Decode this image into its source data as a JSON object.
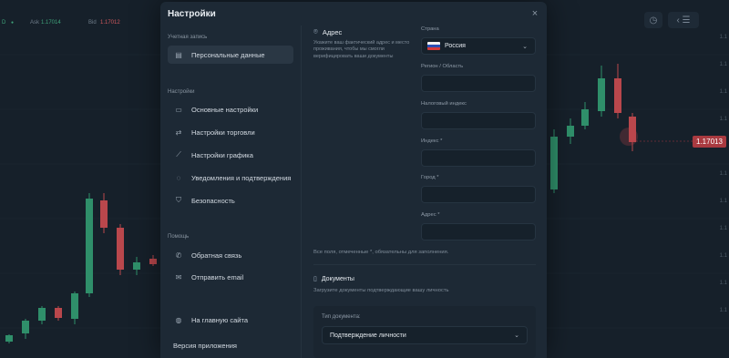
{
  "chart_bar": {
    "symbol_fragment": "D",
    "ask_label": "Ask",
    "ask_value": "1.17014",
    "bid_label": "Bid",
    "bid_value": "1.17012",
    "current_price": "1.17013"
  },
  "modal": {
    "title": "Настройки",
    "close_glyph": "×"
  },
  "sidebar": {
    "account_section": "Учетная запись",
    "personal_data": "Персональные данные",
    "settings_section": "Настройки",
    "items": [
      {
        "label": "Основные настройки",
        "icon": "laptop-icon"
      },
      {
        "label": "Настройки торговли",
        "icon": "exchange-icon"
      },
      {
        "label": "Настройки графика",
        "icon": "chart-icon"
      },
      {
        "label": "Уведомления и подтверждения",
        "icon": "bell-icon"
      },
      {
        "label": "Безопасность",
        "icon": "shield-icon"
      }
    ],
    "help_section": "Помощь",
    "feedback": "Обратная связь",
    "send_email": "Отправить email",
    "home_site": "На главную сайта",
    "app_version": "Версия приложения"
  },
  "address": {
    "title": "Адрес",
    "description": "Укажите ваш фактический адрес и место проживания, чтобы мы смогли верифицировать ваши документы",
    "country_label": "Страна",
    "country_value": "Россия",
    "region_label": "Регион / Область",
    "tax_label": "Налоговый индекс",
    "index_label": "Индекс *",
    "city_label": "Город *",
    "address_label": "Адрес *",
    "required_note": "Все поля, отмеченные *, обязательны для заполнения."
  },
  "documents": {
    "title": "Документы",
    "description": "Загрузите документы подтверждающие вашу личность",
    "type_label": "Тип документа:",
    "type_value": "Подтверждение личности"
  },
  "colors": {
    "bull": "#2f8f6a",
    "bear": "#b9474c",
    "modal_bg": "#1d2935"
  }
}
